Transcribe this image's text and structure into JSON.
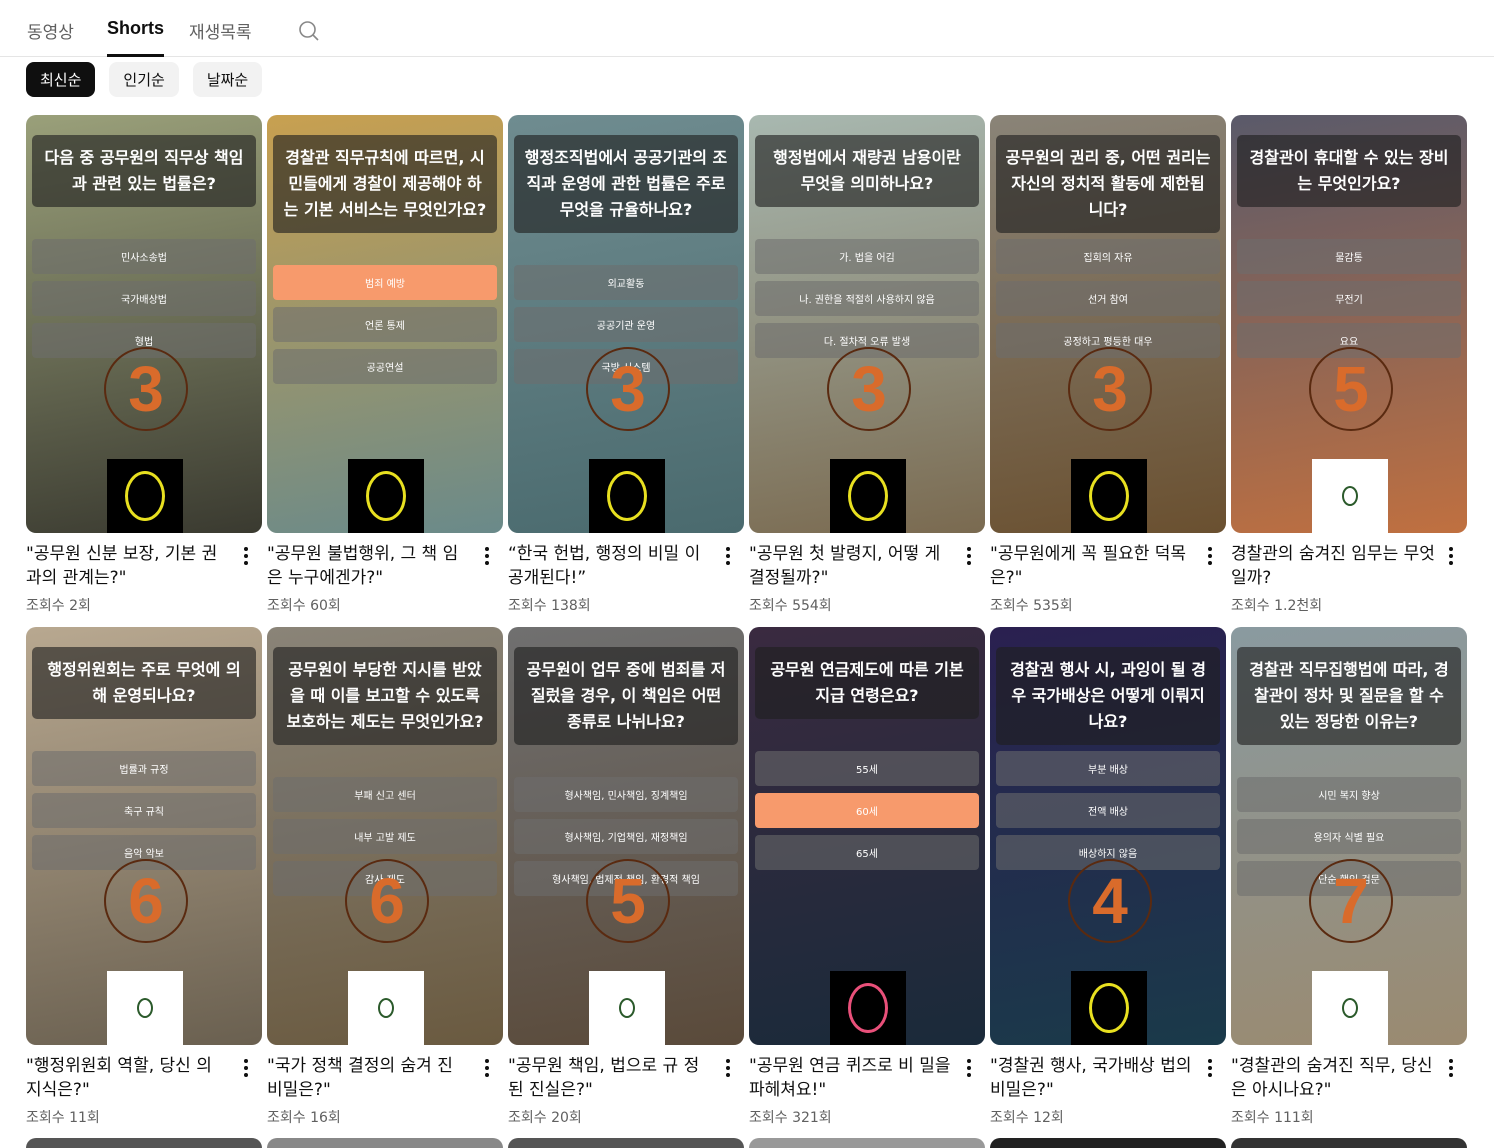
{
  "tabs": [
    {
      "label": "동영상"
    },
    {
      "label": "Shorts",
      "active": true
    },
    {
      "label": "재생목록"
    }
  ],
  "search_icon": "search-icon",
  "chips": [
    {
      "label": "최신순",
      "selected": true
    },
    {
      "label": "인기순"
    },
    {
      "label": "날짜순"
    }
  ],
  "videos": [
    {
      "title": "\"공무원 신분 보장, 기본 권과의 관계는?\"",
      "views": "조회수 2회",
      "question": "다음 중 공무원의 직무상 책임과 관련 있는 법률은?",
      "options": [
        "민사소송법",
        "국가배상법",
        "형법"
      ],
      "highlight": -1,
      "countdown": "3",
      "bg": [
        "#9aa07a",
        "#3a3a30"
      ],
      "logo": "black"
    },
    {
      "title": "\"공무원 불법행위, 그 책 임은 누구에겐가?\"",
      "views": "조회수 60회",
      "question": "경찰관 직무규칙에 따르면, 시민들에게 경찰이 제공해야 하는 기본 서비스는 무엇인가요?",
      "options": [
        "범죄 예방",
        "언론 통제",
        "공공연설"
      ],
      "highlight": 0,
      "countdown": "",
      "bg": [
        "#c8a050",
        "#6a8a8a"
      ],
      "logo": "black"
    },
    {
      "title": "“한국 헌법, 행정의 비밀 이 공개된다!”",
      "views": "조회수 138회",
      "question": "행정조직법에서 공공기관의 조직과 운영에 관한 법률은 주로 무엇을 규율하나요?",
      "options": [
        "외교활동",
        "공공기관 운영",
        "국방 시스템"
      ],
      "highlight": -1,
      "countdown": "3",
      "bg": [
        "#6f8c90",
        "#4a6a6e"
      ],
      "logo": "black"
    },
    {
      "title": "\"공무원 첫 발령지, 어떻 게 결정될까?\"",
      "views": "조회수 554회",
      "question": "행정법에서 재량권 남용이란 무엇을 의미하나요?",
      "options": [
        "가. 법을 어김",
        "나. 권한을 적절히 사용하지 않음",
        "다. 절차적 오류 발생"
      ],
      "highlight": -1,
      "countdown": "3",
      "bg": [
        "#a8b8b0",
        "#7a6a50"
      ],
      "logo": "black"
    },
    {
      "title": "\"공무원에게 꼭 필요한 덕목은?\"",
      "views": "조회수 535회",
      "question": "공무원의 권리 중, 어떤 권리는 자신의 정치적 활동에 제한됩니다?",
      "options": [
        "집회의 자유",
        "선거 참여",
        "공정하고 평등한 대우"
      ],
      "highlight": -1,
      "countdown": "3",
      "bg": [
        "#8a8478",
        "#6a5030"
      ],
      "logo": "black"
    },
    {
      "title": "경찰관의 숨겨진 임무는 무엇일까?",
      "views": "조회수 1.2천회",
      "question": "경찰관이 휴대할 수 있는 장비는 무엇인가요?",
      "options": [
        "물감통",
        "무전기",
        "요요"
      ],
      "highlight": -1,
      "countdown": "5",
      "bg": [
        "#5a5a6a",
        "#c07040"
      ],
      "logo": "white"
    },
    {
      "title": "\"행정위원회 역할, 당신 의 지식은?\"",
      "views": "조회수 11회",
      "question": "행정위원회는 주로 무엇에 의해 운영되나요?",
      "options": [
        "법률과 규정",
        "축구 규칙",
        "음악 악보"
      ],
      "highlight": -1,
      "countdown": "6",
      "bg": [
        "#b8a890",
        "#6a6050"
      ],
      "logo": "white"
    },
    {
      "title": "\"국가 정책 결정의 숨겨 진 비밀은?\"",
      "views": "조회수 16회",
      "question": "공무원이 부당한 지시를 받았을 때 이를 보고할 수 있도록 보호하는 제도는 무엇인가요?",
      "options": [
        "부패 신고 센터",
        "내부 고발 제도",
        "감사 제도"
      ],
      "highlight": -1,
      "countdown": "6",
      "bg": [
        "#8a8478",
        "#6a5a40"
      ],
      "logo": "white"
    },
    {
      "title": "\"공무원 책임, 법으로 규 정된 진실은?\"",
      "views": "조회수 20회",
      "question": "공무원이 업무 중에 범죄를 저질렀을 경우, 이 책임은 어떤 종류로 나뉘나요?",
      "options": [
        "형사책임, 민사책임, 징계책임",
        "형사책임, 기업책임, 재정책임",
        "형사책임, 법제적 책임, 환경적 책임"
      ],
      "highlight": -1,
      "countdown": "5",
      "bg": [
        "#707070",
        "#5a4a3a"
      ],
      "logo": "white"
    },
    {
      "title": "\"공무원 연금 퀴즈로 비 밀을 파헤쳐요!\"",
      "views": "조회수 321회",
      "question": "공무원 연금제도에 따른 기본 지급 연령은요?",
      "options": [
        "55세",
        "60세",
        "65세"
      ],
      "highlight": 1,
      "countdown": "",
      "bg": [
        "#3a2a40",
        "#1a2a3a"
      ],
      "logo": "pink"
    },
    {
      "title": "\"경찰권 행사, 국가배상 법의 비밀은?\"",
      "views": "조회수 12회",
      "question": "경찰권 행사 시, 과잉이 될 경우 국가배상은 어떻게 이뤄지나요?",
      "options": [
        "부분 배상",
        "전액 배상",
        "배상하지 않음"
      ],
      "highlight": -1,
      "countdown": "4",
      "bg": [
        "#2a2050",
        "#1a3a4a"
      ],
      "logo": "black"
    },
    {
      "title": "\"경찰관의 숨겨진 직무, 당신은 아시나요?\"",
      "views": "조회수 111회",
      "question": "경찰관 직무집행법에 따라, 경찰관이 정차 및 질문을 할 수 있는 정당한 이유는?",
      "options": [
        "시민 복지 향상",
        "용의자 식별 필요",
        "단순 행인 검문"
      ],
      "highlight": -1,
      "countdown": "7",
      "bg": [
        "#8a9aa0",
        "#9a8a70"
      ],
      "logo": "white"
    }
  ]
}
